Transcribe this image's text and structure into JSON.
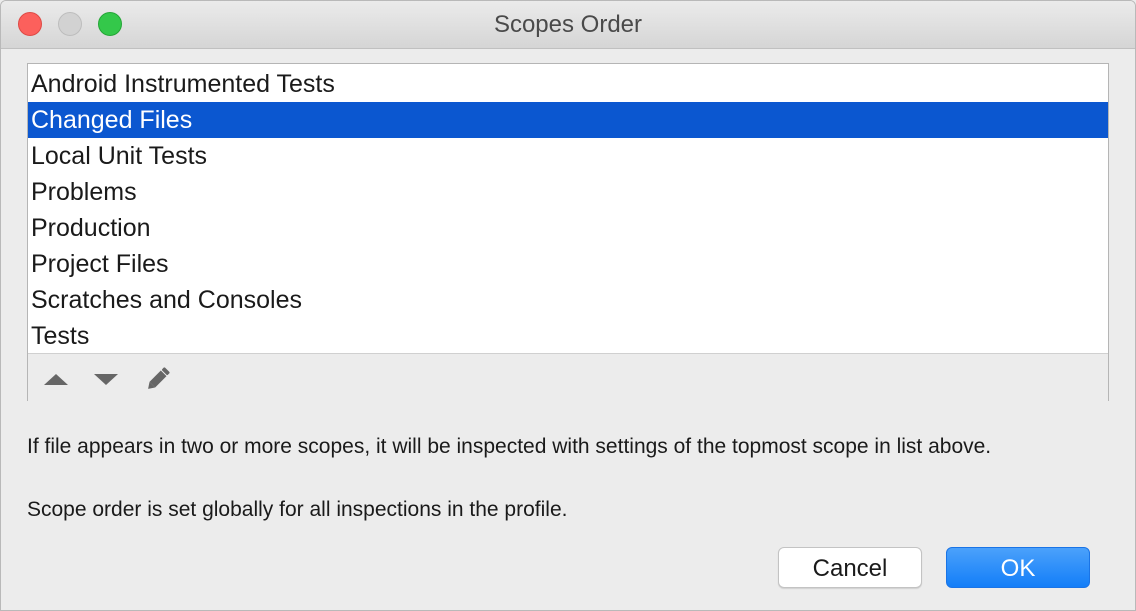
{
  "window": {
    "title": "Scopes Order"
  },
  "list": {
    "items": [
      {
        "label": "Android Instrumented Tests",
        "selected": false
      },
      {
        "label": "Changed Files",
        "selected": true
      },
      {
        "label": "Local Unit Tests",
        "selected": false
      },
      {
        "label": "Problems",
        "selected": false
      },
      {
        "label": "Production",
        "selected": false
      },
      {
        "label": "Project Files",
        "selected": false
      },
      {
        "label": "Scratches and Consoles",
        "selected": false
      },
      {
        "label": "Tests",
        "selected": false
      }
    ],
    "toolbar_icons": [
      "move-up-icon",
      "move-down-icon",
      "edit-icon"
    ]
  },
  "messages": {
    "line1": "If file appears in two or more scopes, it will be inspected with settings of the topmost scope in list above.",
    "line2": "Scope order is set globally for all inspections in the profile."
  },
  "buttons": {
    "cancel": "Cancel",
    "ok": "OK"
  },
  "colors": {
    "selection": "#0b57d0",
    "primary_button": "#137ef8"
  }
}
